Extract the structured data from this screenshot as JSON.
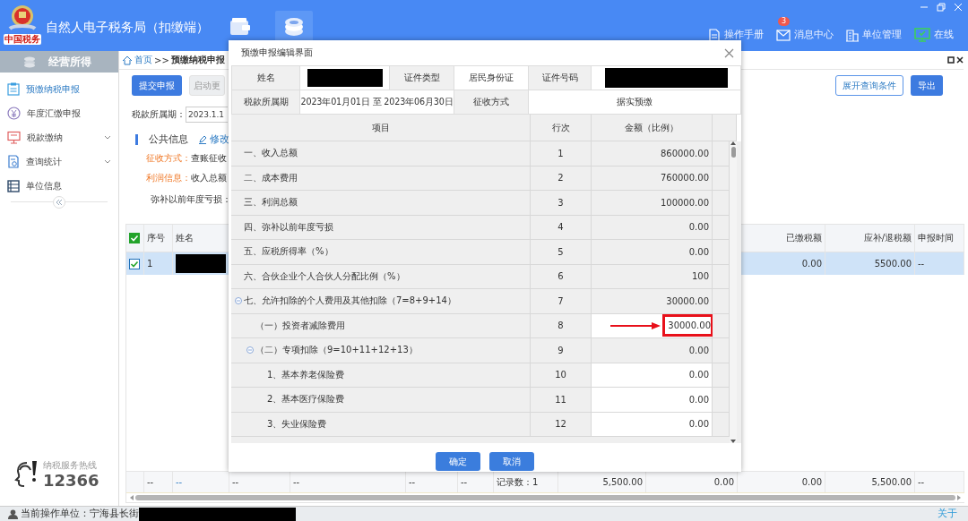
{
  "header": {
    "logo_text": "中国税务",
    "title": "自然人电子税务局（扣缴端）",
    "nav": [
      {
        "selected": false
      },
      {
        "selected": true
      }
    ],
    "actions": [
      {
        "kind": "manual",
        "label": "操作手册"
      },
      {
        "kind": "messages",
        "label": "消息中心",
        "badge": "3"
      },
      {
        "kind": "org",
        "label": "单位管理"
      },
      {
        "kind": "online",
        "label": "在线"
      }
    ]
  },
  "sidebar": {
    "title": "经营所得",
    "items": [
      {
        "label": "预缴纳税申报",
        "selected": true,
        "expandable": false
      },
      {
        "label": "年度汇缴申报",
        "selected": false,
        "expandable": false
      },
      {
        "label": "税款缴纳",
        "selected": false,
        "expandable": true
      },
      {
        "label": "查询统计",
        "selected": false,
        "expandable": true
      },
      {
        "label": "单位信息",
        "selected": false,
        "expandable": false
      }
    ],
    "hotline": {
      "label": "纳税服务热线",
      "number": "12366"
    }
  },
  "breadcrumb": {
    "home": "首页",
    "separator": ">>",
    "current": "预缴纳税申报"
  },
  "toolbar": {
    "left": [
      {
        "label": "提交申报",
        "kind": "primary"
      },
      {
        "label": "启动更",
        "kind": "default"
      }
    ],
    "right": [
      {
        "label": "展开查询条件",
        "kind": "outline"
      },
      {
        "label": "导出",
        "kind": "primary"
      }
    ]
  },
  "filter": {
    "label": "税款所属期：",
    "value": "2023.1.1"
  },
  "public_info": {
    "title": "公共信息",
    "edit_link": "修改",
    "lines": [
      {
        "label": "征收方式：",
        "value": "查账征收"
      },
      {
        "label": "利润信息：",
        "value": "收入总额"
      }
    ],
    "loss_label": "弥补以前年度亏损："
  },
  "table": {
    "header_checked": true,
    "columns": [
      "序号",
      "姓名",
      "已缴税额",
      "应补/退税额",
      "申报时间"
    ],
    "rows": [
      {
        "checked": true,
        "selected": true,
        "seq": "1",
        "paid": "0.00",
        "due": "5500.00",
        "time": "--"
      }
    ],
    "totals": [
      {
        "kind": "text",
        "text": "--"
      },
      {
        "kind": "link",
        "text": "--"
      },
      {
        "kind": "text",
        "text": "--"
      },
      {
        "kind": "text",
        "text": "--"
      },
      {
        "kind": "text",
        "text": "--"
      },
      {
        "kind": "text",
        "text": "--"
      },
      {
        "kind": "text",
        "text": "记录数：1"
      },
      {
        "kind": "number",
        "text": "5,500.00"
      },
      {
        "kind": "number",
        "text": "0.00"
      },
      {
        "kind": "number",
        "text": "0.00"
      },
      {
        "kind": "number",
        "text": "5,500.00"
      },
      {
        "kind": "text",
        "text": "--"
      }
    ]
  },
  "dialog": {
    "title": "预缴申报编辑界面",
    "info": {
      "name_label": "姓名",
      "id_type_label": "证件类型",
      "id_type": "居民身份证",
      "id_number_label": "证件号码",
      "period_label": "税款所属期",
      "period": "2023年01月01日 至 2023年06月30日",
      "method_label": "征收方式",
      "method": "据实预缴"
    },
    "columns": [
      "项目",
      "行次",
      "金额（比例）"
    ],
    "rows": [
      {
        "item": "一、收入总额",
        "line": "1",
        "amount": "860000.00",
        "editable": false
      },
      {
        "item": "二、成本费用",
        "line": "2",
        "amount": "760000.00",
        "editable": false
      },
      {
        "item": "三、利润总额",
        "line": "3",
        "amount": "100000.00",
        "editable": false
      },
      {
        "item": "四、弥补以前年度亏损",
        "line": "4",
        "amount": "0.00",
        "editable": false
      },
      {
        "item": "五、应税所得率（%）",
        "line": "5",
        "amount": "0.00",
        "editable": false
      },
      {
        "item": "六、合伙企业个人合伙人分配比例（%）",
        "line": "6",
        "amount": "100",
        "editable": false
      },
      {
        "item": "七、允许扣除的个人费用及其他扣除（7=8+9+14）",
        "line": "7",
        "amount": "30000.00",
        "editable": false,
        "expanded": true,
        "children": [
          {
            "item": "（一）投资者减除费用",
            "line": "8",
            "amount": "30000.00",
            "editable": true,
            "highlighted": true
          },
          {
            "item": "（二）专项扣除（9=10+11+12+13）",
            "line": "9",
            "amount": "0.00",
            "editable": false,
            "expanded": true,
            "children": [
              {
                "item": "1、基本养老保险费",
                "line": "10",
                "amount": "0.00",
                "editable": true
              },
              {
                "item": "2、基本医疗保险费",
                "line": "11",
                "amount": "0.00",
                "editable": true
              },
              {
                "item": "3、失业保险费",
                "line": "12",
                "amount": "0.00",
                "editable": true
              }
            ]
          }
        ]
      }
    ],
    "buttons": [
      {
        "label": "确定",
        "kind": "primary"
      },
      {
        "label": "取消",
        "kind": "primary"
      }
    ]
  },
  "status_bar": {
    "label": "当前操作单位：宁海县长街",
    "about": "关于"
  }
}
